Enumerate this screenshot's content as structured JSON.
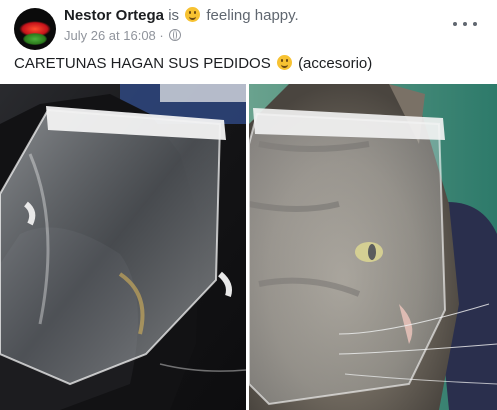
{
  "post": {
    "author": "Nestor Ortega",
    "is_text": "is",
    "feeling_text": "feeling happy.",
    "timestamp": "July 26 at 16:08",
    "separator": "·",
    "privacy_icon": "globe-icon",
    "more_icon": "more-options-icon",
    "caption_text": "CARETUNAS HAGAN SUS PEDIDOS",
    "caption_emoji": "smile-emoji",
    "caption_suffix": "(accesorio)"
  },
  "photos": [
    {
      "icon": "photo-face-shield-black-cat"
    },
    {
      "icon": "photo-face-shield-tabby-cat"
    }
  ],
  "colors": {
    "text": "#1c1e21",
    "secondary": "#606770",
    "timestamp": "#90949c",
    "emoji": "#f7c232"
  }
}
